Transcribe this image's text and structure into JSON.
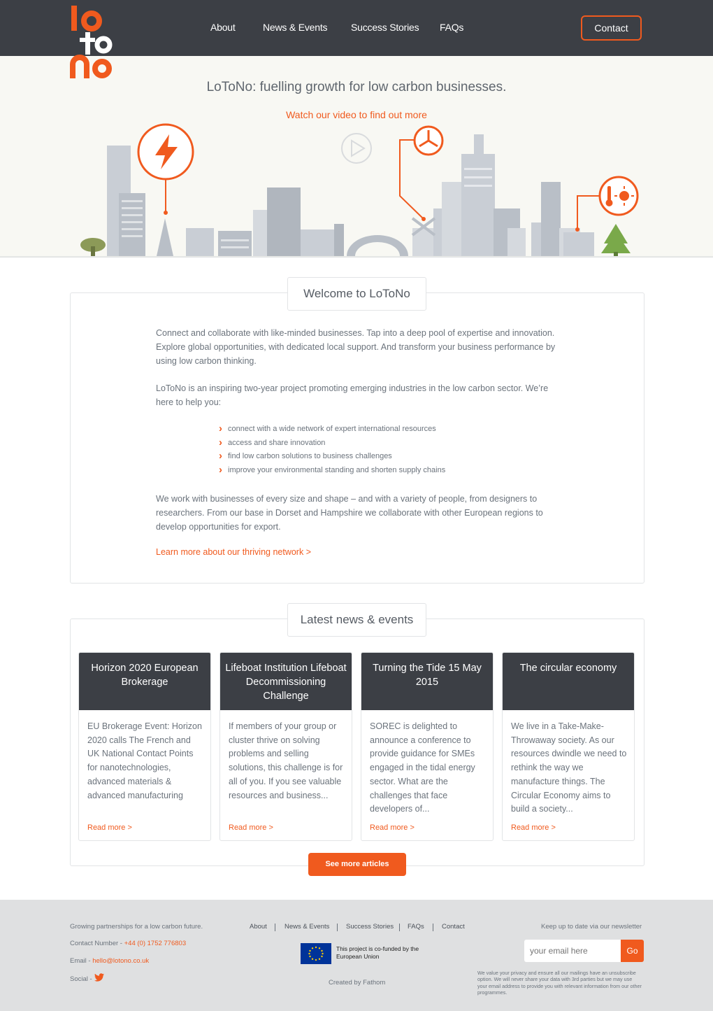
{
  "header": {
    "nav": [
      "About",
      "News & Events",
      "Success Stories",
      "FAQs"
    ],
    "contact_label": "Contact"
  },
  "hero": {
    "title": "LoToNo: fuelling growth for low carbon businesses.",
    "video_link": "Watch our video to find out more"
  },
  "welcome": {
    "heading": "Welcome to LoToNo",
    "para1": "Connect and collaborate with like-minded businesses. Tap into a deep pool of expertise and innovation. Explore global opportunities, with dedicated local support. And transform your business performance by using low carbon thinking.",
    "para2": "LoToNo is an inspiring two-year project promoting emerging industries in the low carbon sector. We’re here to help you:",
    "bullets": [
      "connect with a wide network of expert international resources",
      "access and share innovation",
      "find low carbon solutions to business challenges",
      "improve your environmental standing and shorten supply chains"
    ],
    "para3": "We work with businesses of every size and shape – and with a variety of people, from designers to researchers. From our base in Dorset and Hampshire we collaborate with other European regions to develop opportunities for export.",
    "learn_more": "Learn more about our thriving network >"
  },
  "news": {
    "heading": "Latest news & events",
    "cards": [
      {
        "title": "Horizon 2020 European Brokerage",
        "body": "EU Brokerage Event: Horizon 2020 calls The French and UK National Contact Points for nanotechnologies, advanced materials & advanced manufacturing",
        "more": "Read more >"
      },
      {
        "title": "Lifeboat Institution Lifeboat Decommissioning Challenge",
        "body": "If members of your group or cluster thrive on solving problems and selling solutions, this challenge is for all of you. If you see valuable resources and business...",
        "more": "Read more >"
      },
      {
        "title": "Turning the Tide 15 May 2015",
        "body": "SOREC is delighted to announce a conference  to provide guidance for SMEs engaged in the tidal energy sector. What are the challenges that face developers of...",
        "more": "Read more >"
      },
      {
        "title": "The circular economy",
        "body": "We live in a Take-Make-Throwaway society. As our resources dwindle we need to rethink the way we manufacture things. The Circular Economy aims to build a society...",
        "more": "Read more >"
      }
    ],
    "see_more": "See more articles"
  },
  "footer": {
    "tagline": "Growing partnerships for a low carbon future.",
    "contact_prefix": "Contact Number - ",
    "phone": "+44 (0) 1752 776803",
    "email_prefix": "Email - ",
    "email": "hello@lotono.co.uk",
    "social_prefix": "Social - ",
    "nav": [
      "About",
      "News & Events",
      "Success Stories",
      "FAQs",
      "Contact"
    ],
    "eu_text": "This project is co-funded by the European Union",
    "created_by": "Created by Fathom",
    "newsletter_label": "Keep up to date via our newsletter",
    "email_placeholder": "your email here",
    "go_label": "Go",
    "privacy": "We value your privacy and ensure all our mailings have an unsubscribe option. We will never share your data with 3rd parties but we may use your email address to provide you with relevant information from our other programmes."
  },
  "colors": {
    "accent": "#f05a1e",
    "header_bg": "#3c3f45",
    "hero_bg": "#f8f8f3",
    "footer_bg": "#dfe0e1"
  }
}
